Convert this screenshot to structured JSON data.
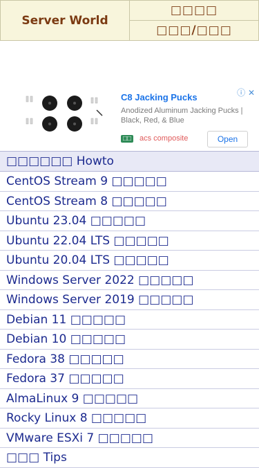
{
  "header": {
    "brand": "Server World",
    "cell_top_right": "□□□□",
    "cell_bottom_right": "□□□/□□□"
  },
  "ad": {
    "title": "C8 Jacking Pucks",
    "description": "Anodized Aluminum Jacking Pucks | Black, Red, & Blue",
    "badge": "□□",
    "source": "acs composite",
    "button": "Open",
    "close": "ⓘ ✕",
    "product_icon": "jacking-pucks-image-icon"
  },
  "menu": {
    "heading": "□□□□□□ Howto",
    "items": [
      "CentOS Stream 9 □□□□□",
      "CentOS Stream 8 □□□□□",
      "Ubuntu 23.04 □□□□□",
      "Ubuntu 22.04 LTS □□□□□",
      "Ubuntu 20.04 LTS □□□□□",
      "Windows Server 2022 □□□□□",
      "Windows Server 2019 □□□□□",
      "Debian 11 □□□□□",
      "Debian 10 □□□□□",
      "Fedora 38 □□□□□",
      "Fedora 37 □□□□□",
      "AlmaLinux 9 □□□□□",
      "Rocky Linux 8 □□□□□",
      "VMware ESXi 7 □□□□□",
      "□□□ Tips"
    ]
  },
  "colors": {
    "header_bg": "#f8f5dc",
    "header_text": "#7b3a12",
    "menu_text": "#1c2a8f",
    "menu_head_bg": "#e8e9f6"
  }
}
